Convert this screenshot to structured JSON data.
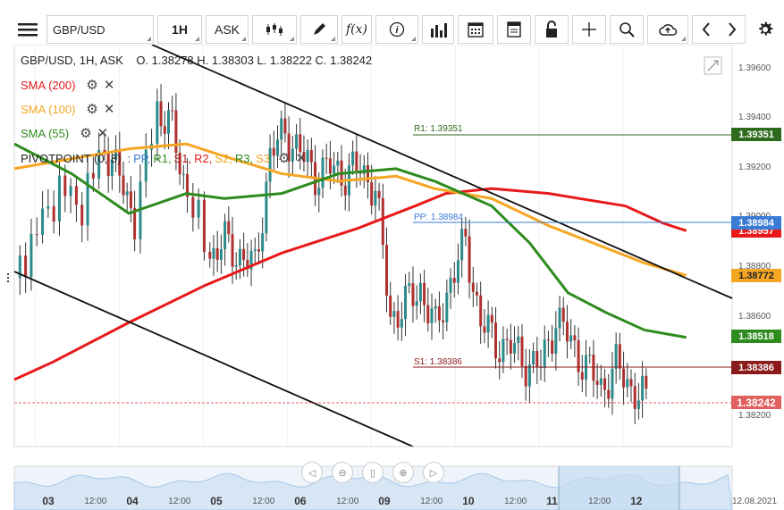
{
  "toolbar": {
    "symbol": "GBP/USD",
    "interval": "1H",
    "price_type": "ASK"
  },
  "legend": {
    "ohlc": "GBP/USD, 1H, ASK    O. 1.38278 H. 1.38303 L. 1.38222 C. 1.38242",
    "indicators": [
      {
        "label": "SMA (200)",
        "color": "#e8191a"
      },
      {
        "label": "SMA (100)",
        "color": "#f5a623"
      },
      {
        "label": "SMA (55)",
        "color": "#2e8b1e"
      }
    ],
    "pivot": {
      "label": "PIVOTPOINT (0, 8)",
      "parts": [
        ":",
        "PP,",
        "R1,",
        "S1,",
        "R2,",
        "S2,",
        "R3,",
        "S3"
      ],
      "part_colors": [
        "#555",
        "#3a7bd5",
        "#2e8b1e",
        "#b22222",
        "#e8191a",
        "#f5a623",
        "#2e8b1e",
        "#f5a623"
      ]
    }
  },
  "levels": {
    "r1": {
      "label": "R1: 1.39351",
      "tag": "1.39351",
      "color": "#2e6b1e"
    },
    "pp": {
      "label": "PP: 1.38984",
      "tag": "1.38984",
      "color": "#3a7bd5"
    },
    "s1": {
      "label": "S1: 1.38386",
      "tag": "1.38386",
      "color": "#8b1a1a"
    }
  },
  "price_tags": [
    {
      "value": "1.38957",
      "color": "#e8191a"
    },
    {
      "value": "1.38772",
      "color": "#f5a623"
    },
    {
      "value": "1.38518",
      "color": "#2e8b1e"
    },
    {
      "value": "1.38242",
      "color": "#e06060"
    }
  ],
  "y_axis": [
    "1.39600",
    "1.39400",
    "1.39200",
    "1.39000",
    "1.38800",
    "1.38600",
    "1.38400",
    "1.38200"
  ],
  "x_axis": {
    "days": [
      "03",
      "04",
      "05",
      "06",
      "09",
      "10",
      "11",
      "12"
    ],
    "hours": [
      "12:00",
      "12:00",
      "12:00",
      "12:00",
      "12:00",
      "12:00",
      "12:00"
    ],
    "date": "12.08.2021"
  },
  "chart_data": {
    "type": "candlestick",
    "title": "",
    "ylim": [
      1.3808,
      1.397
    ],
    "x_range_hours": [
      0,
      188
    ],
    "candles": [],
    "sma200": [
      [
        0,
        1.3835
      ],
      [
        10,
        1.3842
      ],
      [
        30,
        1.3858
      ],
      [
        50,
        1.3873
      ],
      [
        70,
        1.3886
      ],
      [
        90,
        1.3896
      ],
      [
        105,
        1.3905
      ],
      [
        113,
        1.391
      ],
      [
        125,
        1.3912
      ],
      [
        140,
        1.391
      ],
      [
        160,
        1.3905
      ],
      [
        170,
        1.3898
      ],
      [
        176,
        1.3895
      ]
    ],
    "sma100": [
      [
        0,
        1.392
      ],
      [
        15,
        1.3924
      ],
      [
        30,
        1.3928
      ],
      [
        45,
        1.393
      ],
      [
        55,
        1.3925
      ],
      [
        70,
        1.3918
      ],
      [
        85,
        1.3915
      ],
      [
        100,
        1.3917
      ],
      [
        110,
        1.3912
      ],
      [
        125,
        1.3908
      ],
      [
        140,
        1.3897
      ],
      [
        155,
        1.3888
      ],
      [
        165,
        1.3882
      ],
      [
        176,
        1.3877
      ]
    ],
    "sma55": [
      [
        0,
        1.393
      ],
      [
        15,
        1.3918
      ],
      [
        30,
        1.3902
      ],
      [
        45,
        1.391
      ],
      [
        55,
        1.3908
      ],
      [
        70,
        1.391
      ],
      [
        85,
        1.3918
      ],
      [
        100,
        1.392
      ],
      [
        110,
        1.3915
      ],
      [
        125,
        1.3905
      ],
      [
        135,
        1.389
      ],
      [
        145,
        1.387
      ],
      [
        155,
        1.3862
      ],
      [
        165,
        1.3855
      ],
      [
        176,
        1.3852
      ]
    ]
  }
}
